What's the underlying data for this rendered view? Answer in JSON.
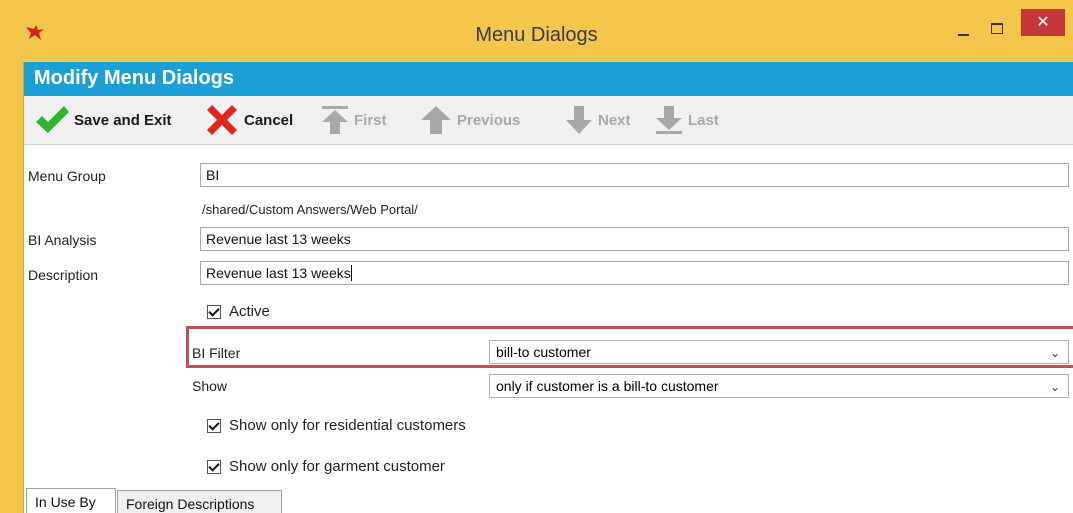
{
  "window": {
    "title": "Menu Dialogs",
    "close_glyph": "✕"
  },
  "header": {
    "title": "Modify Menu Dialogs"
  },
  "toolbar": {
    "save_exit": "Save and Exit",
    "cancel": "Cancel",
    "first": "First",
    "previous": "Previous",
    "next": "Next",
    "last": "Last"
  },
  "form": {
    "menu_group_label": "Menu Group",
    "menu_group_value": "BI",
    "path": "/shared/Custom Answers/Web Portal/",
    "bi_analysis_label": "BI Analysis",
    "bi_analysis_value": "Revenue last 13 weeks",
    "description_label": "Description",
    "description_value": "Revenue last 13 weeks",
    "active_label": "Active",
    "active_checked": true,
    "bi_filter_label": "BI Filter",
    "bi_filter_value": "bill-to customer",
    "show_label": "Show",
    "show_value": "only if customer is a bill-to customer",
    "residential_label": "Show only for residential customers",
    "residential_checked": true,
    "garment_label": "Show only for garment customer",
    "garment_checked": true
  },
  "tabs": [
    {
      "label": "In Use By",
      "active": true
    },
    {
      "label": "Foreign Descriptions",
      "active": false
    }
  ],
  "colors": {
    "title_bar": "#f4c64a",
    "header": "#1a9fd6",
    "close_button": "#c7383b",
    "highlight": "#c2505a",
    "save_check": "#2db52d",
    "cancel_x": "#e0261d"
  },
  "icons": {
    "app": "bird-logo-icon",
    "save": "checkmark-icon",
    "cancel": "x-icon",
    "first": "arrow-up-to-bar-icon",
    "previous": "arrow-up-icon",
    "next": "arrow-down-icon",
    "last": "arrow-down-to-bar-icon",
    "dropdown": "chevron-down-icon"
  }
}
